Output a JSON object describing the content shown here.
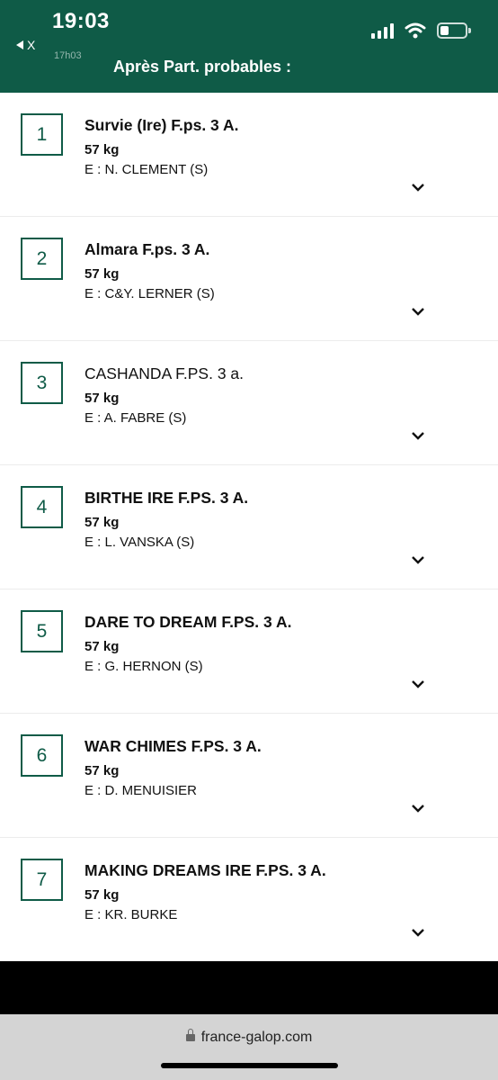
{
  "status_bar": {
    "time": "19:03",
    "back_label": "X"
  },
  "header": {
    "subtitle_cut": "17h03",
    "title": "Après Part. probables :"
  },
  "runners": [
    {
      "number": "1",
      "name": "Survie (Ire) F.ps. 3 A.",
      "weight": "57 kg",
      "trainer": "E : N. CLEMENT (S)"
    },
    {
      "number": "2",
      "name": "Almara F.ps. 3 A.",
      "weight": "57 kg",
      "trainer": "E : C&Y. LERNER (S)"
    },
    {
      "number": "3",
      "name": "CASHANDA F.PS. 3 a.",
      "weight": "57 kg",
      "trainer": "E : A. FABRE (S)"
    },
    {
      "number": "4",
      "name": "BIRTHE IRE F.PS. 3 A.",
      "weight": "57 kg",
      "trainer": "E : L. VANSKA (S)"
    },
    {
      "number": "5",
      "name": "DARE TO DREAM F.PS. 3 A.",
      "weight": "57 kg",
      "trainer": "E : G. HERNON (S)"
    },
    {
      "number": "6",
      "name": "WAR CHIMES F.PS. 3 A.",
      "weight": "57 kg",
      "trainer": "E : D. MENUISIER"
    },
    {
      "number": "7",
      "name": "MAKING DREAMS IRE F.PS. 3 A.",
      "weight": "57 kg",
      "trainer": "E : KR. BURKE"
    }
  ],
  "browser": {
    "url": "france-galop.com"
  },
  "colors": {
    "brand_green": "#0f5b47"
  }
}
